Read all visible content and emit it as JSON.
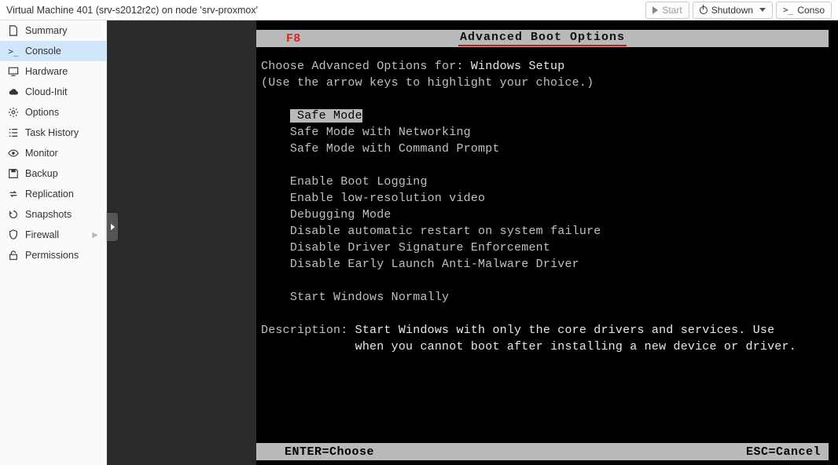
{
  "header": {
    "title": "Virtual Machine 401 (srv-s2012r2c) on node 'srv-proxmox'",
    "start_label": "Start",
    "shutdown_label": "Shutdown",
    "console_label": "Conso"
  },
  "sidebar": {
    "items": [
      {
        "label": "Summary",
        "icon": "doc"
      },
      {
        "label": "Console",
        "icon": "term",
        "active": true
      },
      {
        "label": "Hardware",
        "icon": "monitor"
      },
      {
        "label": "Cloud-Init",
        "icon": "cloud"
      },
      {
        "label": "Options",
        "icon": "gear"
      },
      {
        "label": "Task History",
        "icon": "list"
      },
      {
        "label": "Monitor",
        "icon": "eye"
      },
      {
        "label": "Backup",
        "icon": "save"
      },
      {
        "label": "Replication",
        "icon": "repl"
      },
      {
        "label": "Snapshots",
        "icon": "history"
      },
      {
        "label": "Firewall",
        "icon": "shield",
        "expandable": true
      },
      {
        "label": "Permissions",
        "icon": "unlock"
      }
    ]
  },
  "console": {
    "f8": "F8",
    "title": "Advanced Boot Options",
    "line_choose_prefix": "Choose Advanced Options for: ",
    "line_choose_target": "Windows Setup",
    "line_hint": "(Use the arrow keys to highlight your choice.)",
    "options": [
      "Safe Mode",
      "Safe Mode with Networking",
      "Safe Mode with Command Prompt",
      "",
      "Enable Boot Logging",
      "Enable low-resolution video",
      "Debugging Mode",
      "Disable automatic restart on system failure",
      "Disable Driver Signature Enforcement",
      "Disable Early Launch Anti-Malware Driver",
      "",
      "Start Windows Normally"
    ],
    "selected_index": 0,
    "desc_label": "Description: ",
    "desc_line1": "Start Windows with only the core drivers and services. Use",
    "desc_line2": "when you cannot boot after installing a new device or driver.",
    "footer_left": "ENTER=Choose",
    "footer_right": "ESC=Cancel"
  }
}
